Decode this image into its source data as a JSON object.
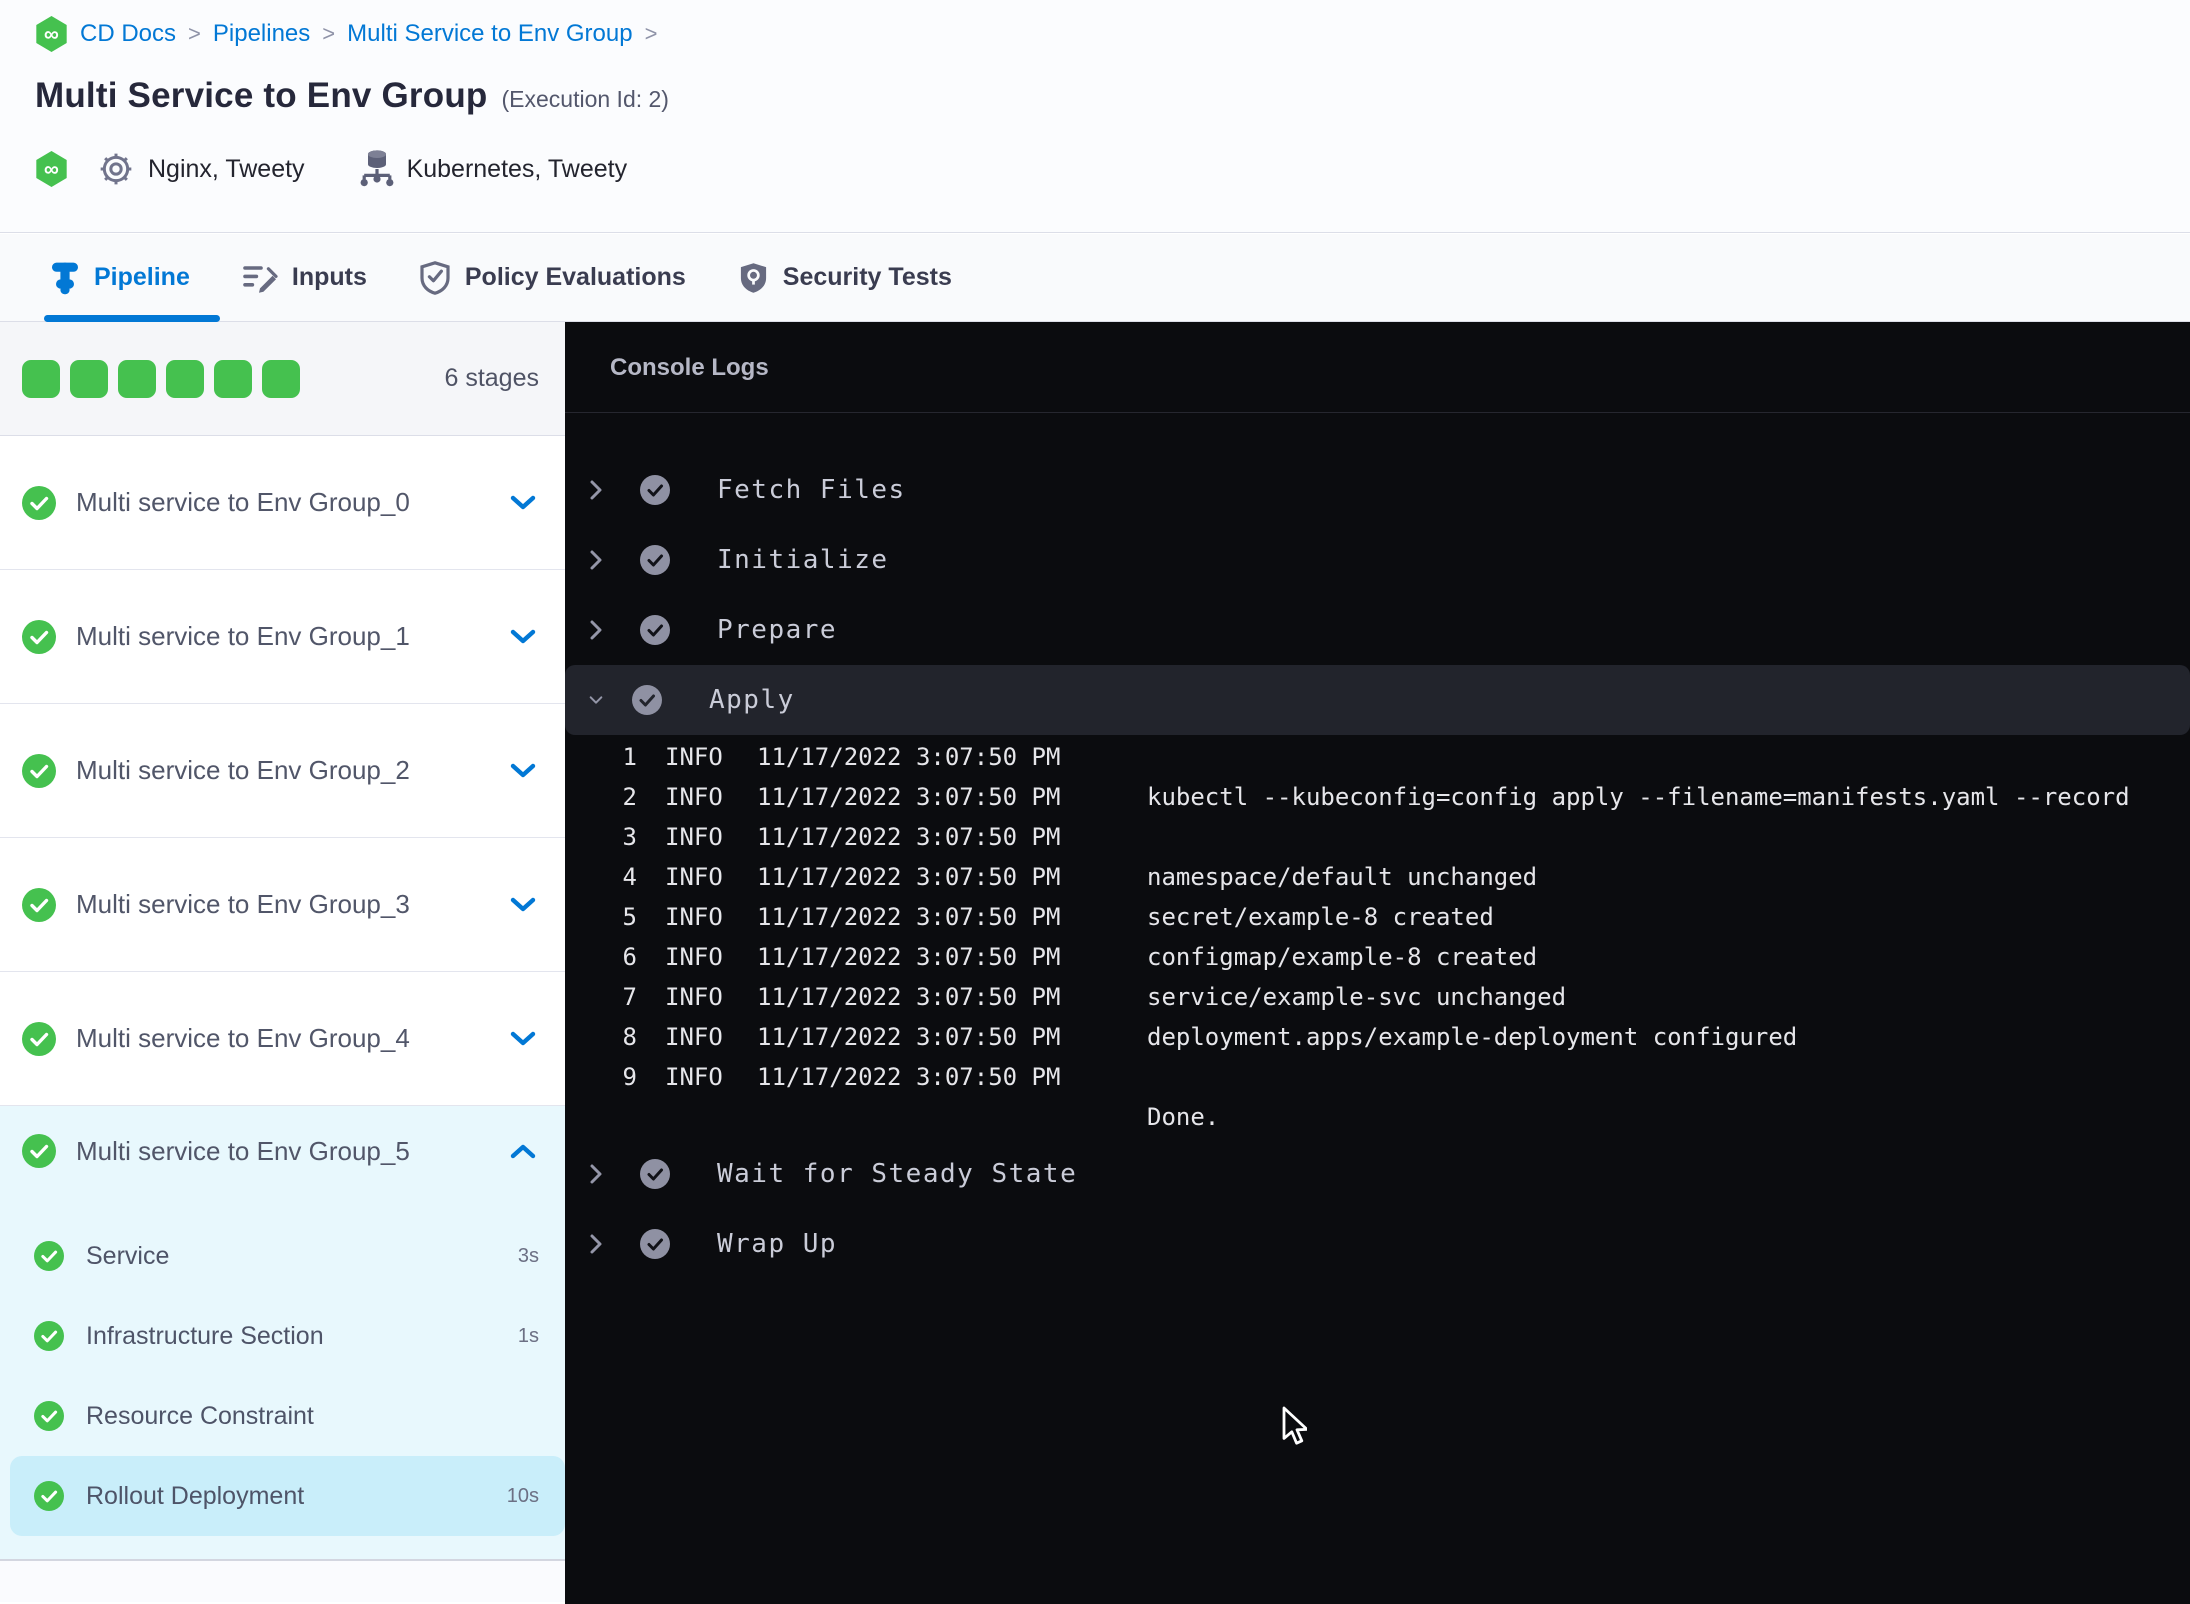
{
  "colors": {
    "accent_blue": "#0278d5",
    "success_green": "#45c14f",
    "console_bg": "#0b0c0f",
    "expanded_stage_bg": "#e8f8fd",
    "selected_step_bg": "#c9eefa",
    "apply_row_bg": "#22242c"
  },
  "breadcrumb": {
    "items": [
      {
        "label": "CD Docs"
      },
      {
        "label": "Pipelines"
      },
      {
        "label": "Multi Service to Env Group"
      }
    ],
    "separator": ">"
  },
  "header": {
    "title": "Multi Service to Env Group",
    "execution_id": "(Execution Id: 2)",
    "service_label": "Nginx, Tweety",
    "infrastructure_label": "Kubernetes, Tweety"
  },
  "tabs": [
    {
      "label": "Pipeline"
    },
    {
      "label": "Inputs"
    },
    {
      "label": "Policy Evaluations"
    },
    {
      "label": "Security Tests"
    }
  ],
  "stages": {
    "count_label": "6 stages",
    "items": [
      {
        "name": "Multi service to Env Group_0"
      },
      {
        "name": "Multi service to Env Group_1"
      },
      {
        "name": "Multi service to Env Group_2"
      },
      {
        "name": "Multi service to Env Group_3"
      },
      {
        "name": "Multi service to Env Group_4"
      }
    ],
    "expanded": {
      "name": "Multi service to Env Group_5",
      "steps": [
        {
          "name": "Service",
          "duration": "3s"
        },
        {
          "name": "Infrastructure Section",
          "duration": "1s"
        },
        {
          "name": "Resource Constraint",
          "duration": ""
        },
        {
          "name": "Rollout Deployment",
          "duration": "10s"
        }
      ]
    }
  },
  "console": {
    "title": "Console Logs",
    "steps_collapsed": [
      {
        "label": "Fetch Files"
      },
      {
        "label": "Initialize"
      },
      {
        "label": "Prepare"
      }
    ],
    "apply_label": "Apply",
    "logs": [
      {
        "n": "1",
        "level": "INFO",
        "ts": "11/17/2022 3:07:50 PM",
        "msg": ""
      },
      {
        "n": "2",
        "level": "INFO",
        "ts": "11/17/2022 3:07:50 PM",
        "msg": "kubectl --kubeconfig=config apply --filename=manifests.yaml --record"
      },
      {
        "n": "3",
        "level": "INFO",
        "ts": "11/17/2022 3:07:50 PM",
        "msg": ""
      },
      {
        "n": "4",
        "level": "INFO",
        "ts": "11/17/2022 3:07:50 PM",
        "msg": "namespace/default unchanged"
      },
      {
        "n": "5",
        "level": "INFO",
        "ts": "11/17/2022 3:07:50 PM",
        "msg": "secret/example-8 created"
      },
      {
        "n": "6",
        "level": "INFO",
        "ts": "11/17/2022 3:07:50 PM",
        "msg": "configmap/example-8 created"
      },
      {
        "n": "7",
        "level": "INFO",
        "ts": "11/17/2022 3:07:50 PM",
        "msg": "service/example-svc unchanged"
      },
      {
        "n": "8",
        "level": "INFO",
        "ts": "11/17/2022 3:07:50 PM",
        "msg": "deployment.apps/example-deployment configured"
      },
      {
        "n": "9",
        "level": "INFO",
        "ts": "11/17/2022 3:07:50 PM",
        "msg": ""
      }
    ],
    "done_line": "Done.",
    "steps_after": [
      {
        "label": "Wait for Steady State"
      },
      {
        "label": "Wrap Up"
      }
    ]
  }
}
